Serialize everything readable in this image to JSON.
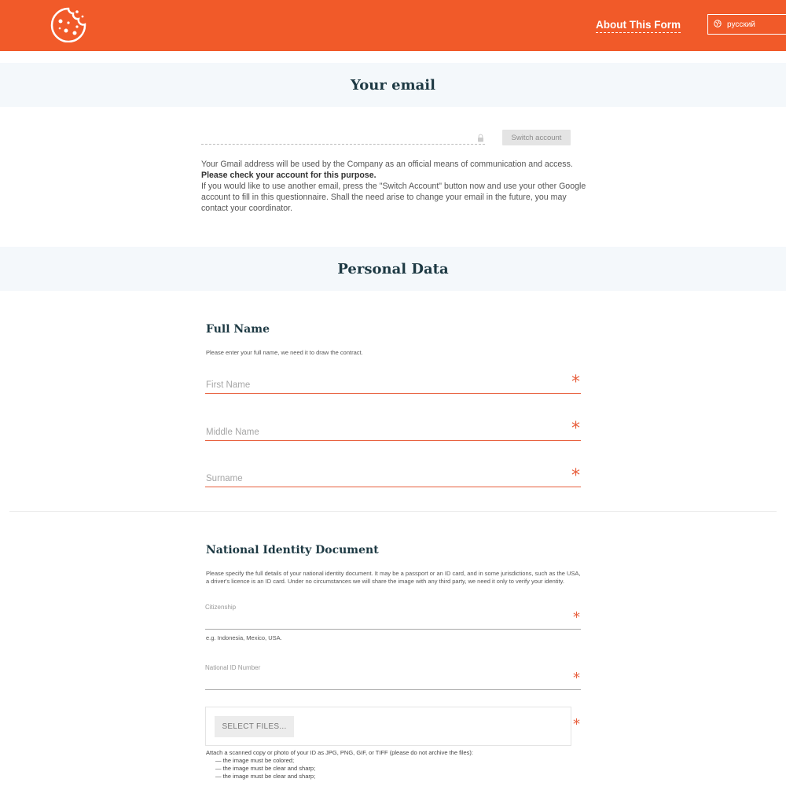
{
  "header": {
    "logo_icon": "cookie-icon",
    "about_link": "About This Form",
    "language": {
      "icon": "globe-icon",
      "label": "русский"
    },
    "color": "#f15a29"
  },
  "email_section": {
    "title": "Your email",
    "email_value": "",
    "lock_icon": "lock-icon",
    "switch_button": "Switch account",
    "info_line1": "Your Gmail address will be used by the Company as an official means of communication and access.",
    "info_bold": "Please check your account for this purpose.",
    "info_rest": "If you would like to use another email, press the \"Switch Account\" button now and use your other Google account to fill in this questionnaire. Shall the need arise to change your email in the future, you may contact your coordinator."
  },
  "personal_section": {
    "title": "Personal Data",
    "full_name": {
      "title": "Full Name",
      "description": "Please enter your full name, we need it to draw the contract.",
      "fields": [
        {
          "placeholder": "First Name",
          "required": "*"
        },
        {
          "placeholder": "Middle Name",
          "required": "*"
        },
        {
          "placeholder": "Surname",
          "required": "*"
        }
      ]
    },
    "identity": {
      "title": "National Identity Document",
      "description": "Please specify the full details of your national identity document. It may be a passport or an ID card, and in some jurisdictions, such as the USA, a driver's licence is an ID card. Under no circumstances we will share the image with any third party, we need it only to verify your identity.",
      "citizenship_label": "Citizenship",
      "citizenship_hint": "e.g. Indonesia, Mexico, USA.",
      "id_number_label": "National ID Number",
      "upload_button": "SELECT FILES...",
      "required": "*",
      "attach_info": "Attach a scanned copy or photo of your ID as JPG, PNG, GIF, or TIFF (please do not archive the files):",
      "rules": [
        "— the image must be colored;",
        "— the image must be clear and sharp;",
        "— the image must be clear and sharp;"
      ]
    }
  },
  "colors": {
    "accent": "#f15a29",
    "heading": "#1d3943",
    "band": "#f4f8fb"
  }
}
